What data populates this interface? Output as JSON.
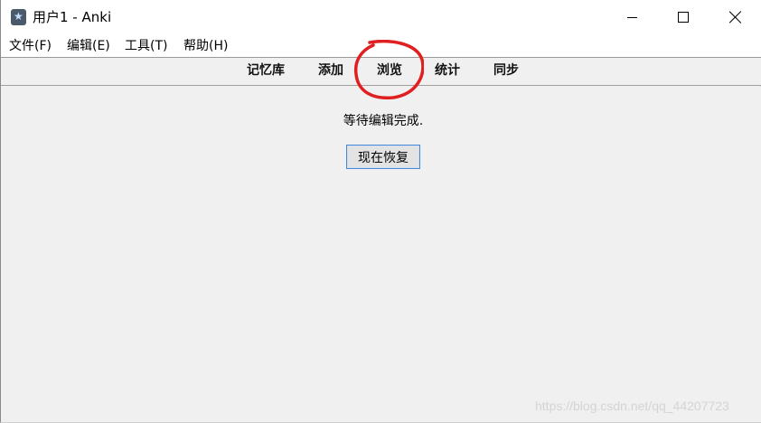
{
  "window": {
    "title": "用户1 - Anki",
    "app_icon": "anki-star-icon",
    "controls": {
      "minimize_icon": "minimize-icon",
      "maximize_icon": "maximize-icon",
      "close_icon": "close-icon"
    }
  },
  "menubar": {
    "items": [
      {
        "label": "文件(F)"
      },
      {
        "label": "编辑(E)"
      },
      {
        "label": "工具(T)"
      },
      {
        "label": "帮助(H)"
      }
    ]
  },
  "toolbar": {
    "links": [
      {
        "label": "记忆库"
      },
      {
        "label": "添加"
      },
      {
        "label": "浏览",
        "highlighted": true
      },
      {
        "label": "统计"
      },
      {
        "label": "同步"
      }
    ],
    "annotation_color": "#e02020"
  },
  "main": {
    "status_message": "等待编辑完成.",
    "resume_button_label": "现在恢复"
  },
  "watermark": "https://blog.csdn.net/qq_44207723",
  "colors": {
    "window_bg": "#f0f0f0",
    "titlebar_bg": "#ffffff",
    "button_focus_border": "#4a88d4",
    "annotation": "#e02020"
  }
}
